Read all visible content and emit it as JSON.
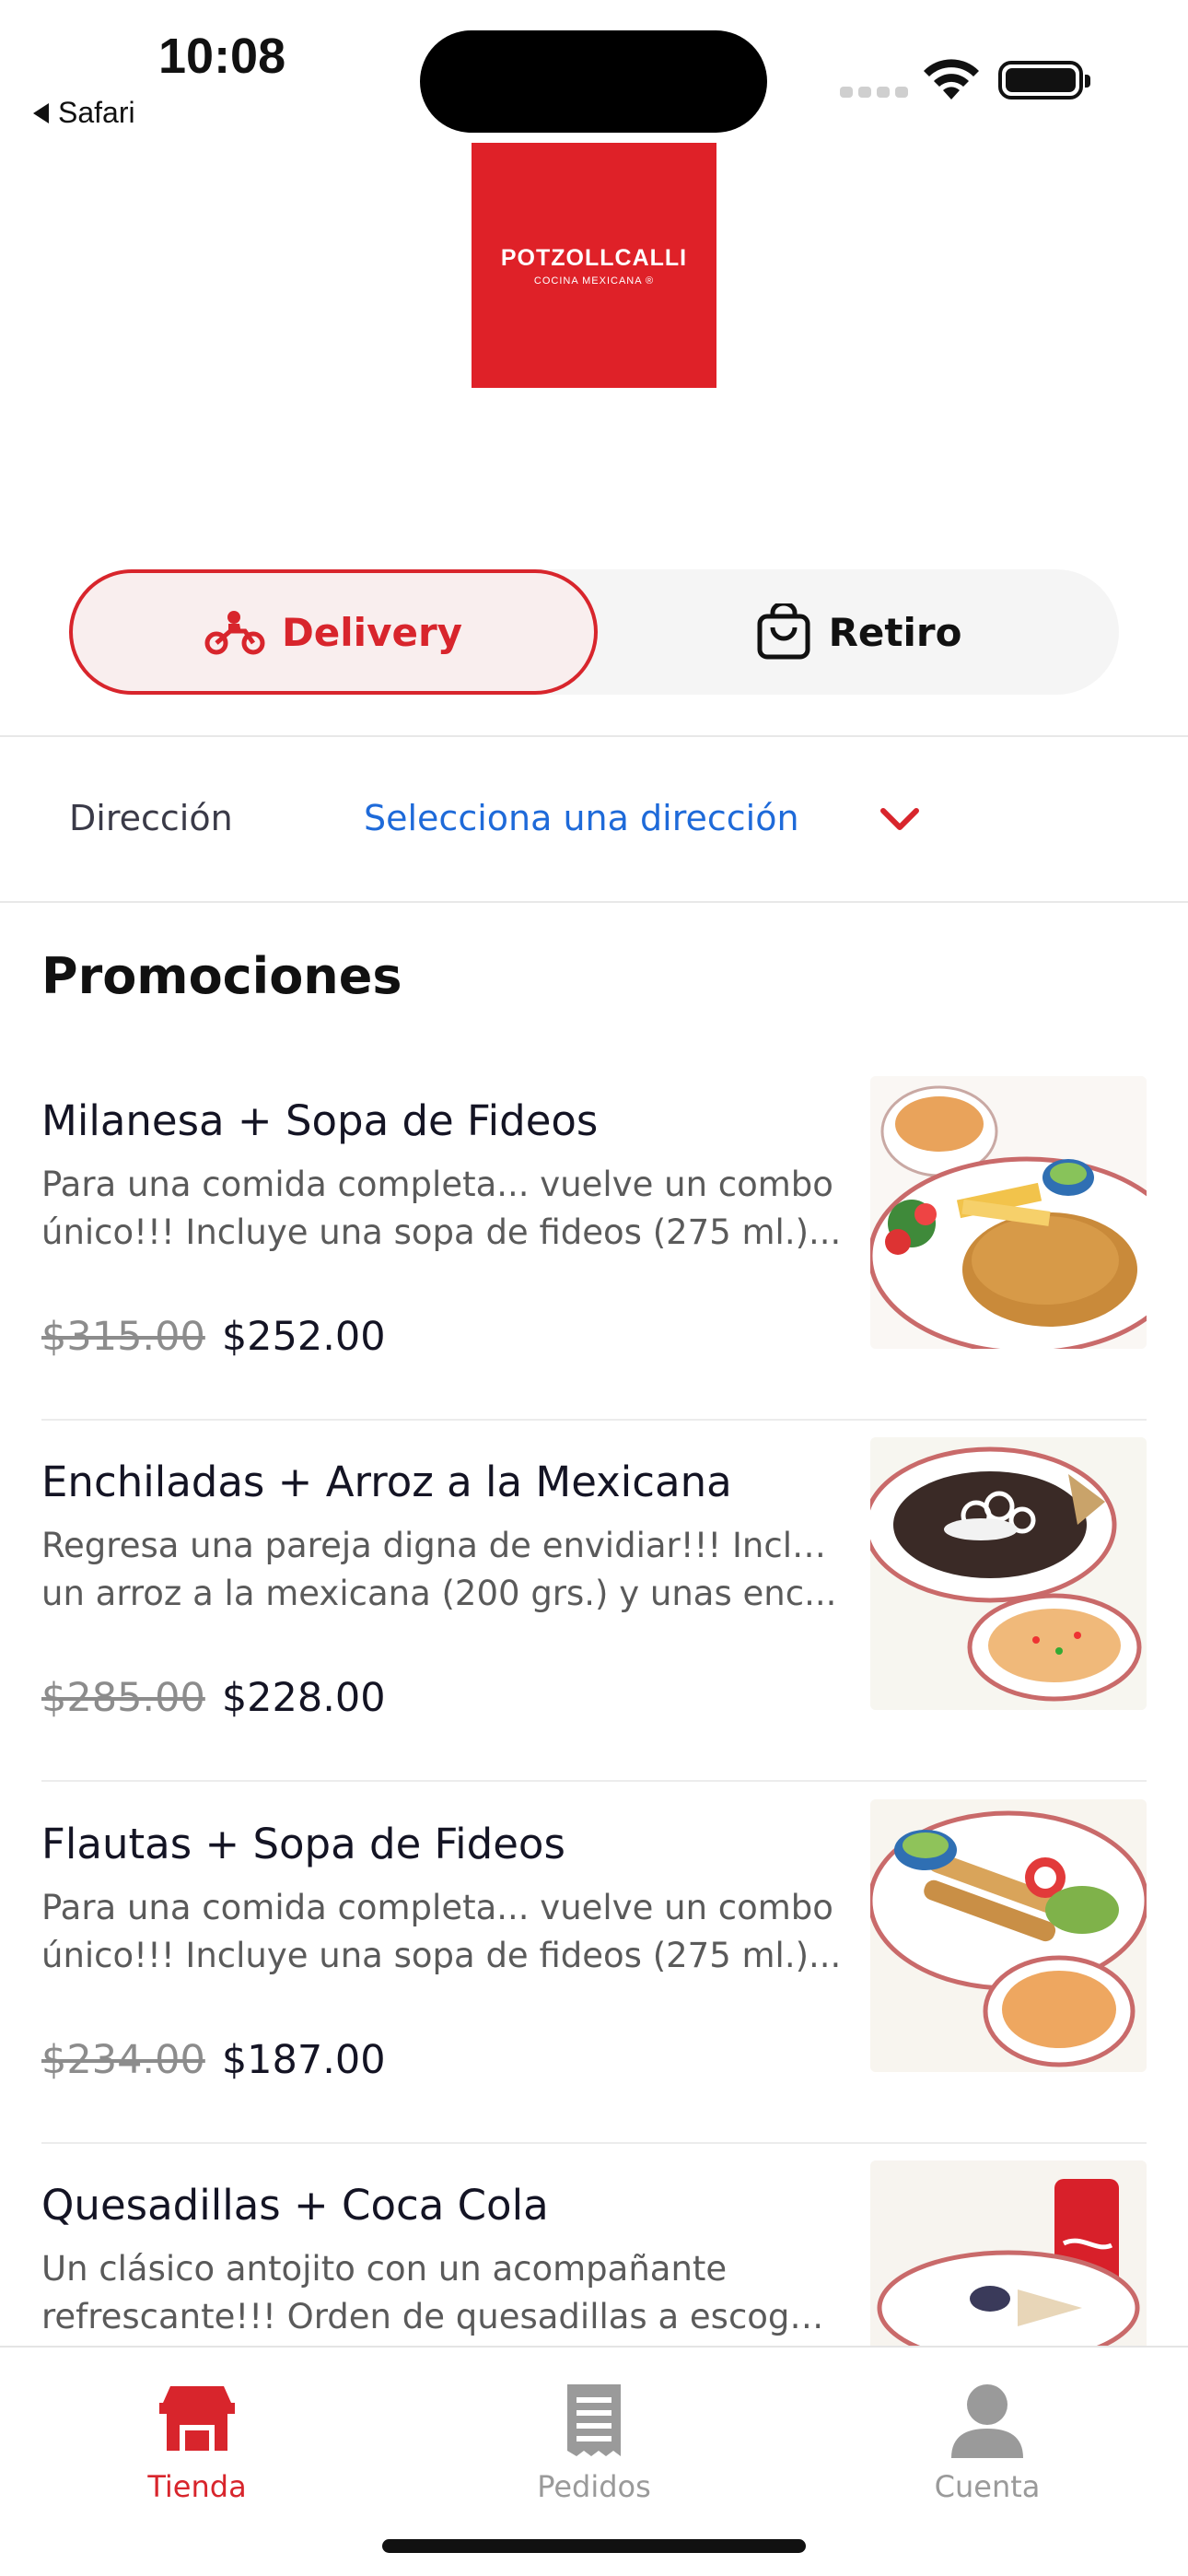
{
  "status_bar": {
    "time": "10:08",
    "back_app": "Safari"
  },
  "logo": {
    "name": "POTZOLLCALLI",
    "subtitle": "COCINA MEXICANA ®",
    "bg_color": "#df2128"
  },
  "order_mode": {
    "options": [
      {
        "label": "Delivery",
        "icon": "motorcycle-icon",
        "selected": true
      },
      {
        "label": "Retiro",
        "icon": "shopping-bag-icon",
        "selected": false
      }
    ]
  },
  "address": {
    "label": "Dirección",
    "value": "Selecciona una dirección",
    "icon": "chevron-down-icon"
  },
  "promotions": {
    "title": "Promociones",
    "items": [
      {
        "name": "Milanesa + Sopa de Fideos",
        "desc_line1": "Para una comida completa... vuelve un combo",
        "desc_line2": "único!!! Incluye una sopa de fideos (275 ml.)...",
        "old_price": "$315.00",
        "price": "$252.00"
      },
      {
        "name": "Enchiladas + Arroz a la Mexicana",
        "desc_line1": "Regresa una pareja digna de envidiar!!! Incluye",
        "desc_line2": "un arroz a la mexicana (200 grs.) y unas enc...",
        "old_price": "$285.00",
        "price": "$228.00"
      },
      {
        "name": "Flautas + Sopa de Fideos",
        "desc_line1": "Para una comida completa... vuelve un combo",
        "desc_line2": "único!!! Incluye una sopa de fideos (275 ml.)...",
        "old_price": "$234.00",
        "price": "$187.00"
      },
      {
        "name": "Quesadillas + Coca Cola",
        "desc_line1": "Un clásico antojito con un acompañante",
        "desc_line2": "refrescante!!! Orden de quesadillas a escoger...",
        "old_price": "",
        "price": ""
      }
    ]
  },
  "tab_bar": {
    "tabs": [
      {
        "label": "Tienda",
        "icon": "store-icon",
        "active": true
      },
      {
        "label": "Pedidos",
        "icon": "receipt-icon",
        "active": false
      },
      {
        "label": "Cuenta",
        "icon": "person-icon",
        "active": false
      }
    ],
    "active_color": "#d8252c",
    "inactive_color": "#9a9a9a"
  }
}
